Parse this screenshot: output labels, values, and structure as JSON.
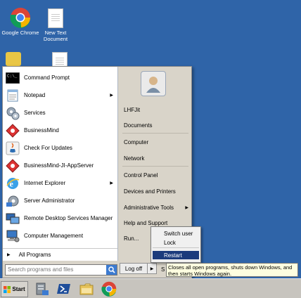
{
  "desktop": {
    "icons": [
      {
        "label": "Google Chrome",
        "icon": "chrome-icon"
      },
      {
        "label": "New Text\nDocument",
        "icon": "text-document-icon"
      }
    ]
  },
  "start_menu": {
    "programs": [
      {
        "label": "Command Prompt",
        "icon": "command-prompt-icon",
        "has_submenu": false
      },
      {
        "label": "Notepad",
        "icon": "notepad-icon",
        "has_submenu": true
      },
      {
        "label": "Services",
        "icon": "services-icon",
        "has_submenu": false
      },
      {
        "label": "BusinessMind",
        "icon": "businessmind-icon",
        "has_submenu": false
      },
      {
        "label": "Check For Updates",
        "icon": "java-icon",
        "has_submenu": false
      },
      {
        "label": "BusinessMind-JI-AppServer",
        "icon": "businessmind-appserver-icon",
        "has_submenu": false
      },
      {
        "label": "Internet Explorer",
        "icon": "internet-explorer-icon",
        "has_submenu": true
      },
      {
        "label": "Server Administrator",
        "icon": "server-admin-icon",
        "has_submenu": false
      },
      {
        "label": "Remote Desktop Services Manager",
        "icon": "remote-desktop-icon",
        "has_submenu": false
      },
      {
        "label": "Computer Management",
        "icon": "computer-management-icon",
        "has_submenu": false
      }
    ],
    "all_programs": "All Programs",
    "search_placeholder": "Search programs and files",
    "right": {
      "user": "LHFJit",
      "documents": "Documents",
      "computer": "Computer",
      "network": "Network",
      "control_panel": "Control Panel",
      "devices_printers": "Devices and Printers",
      "admin_tools": "Administrative Tools",
      "help_support": "Help and Support",
      "run": "Run..."
    },
    "log_off": "Log off",
    "shutdown_partial": "S"
  },
  "power_menu": {
    "switch_user": "Switch user",
    "lock": "Lock",
    "restart": "Restart"
  },
  "tooltip": "Closes all open programs, shuts down Windows, and then starts Windows again.",
  "taskbar": {
    "start_label": "Start",
    "pinned": [
      "server-manager-icon",
      "powershell-icon",
      "file-explorer-icon",
      "chrome-icon"
    ]
  },
  "colors": {
    "desktop": "#2f64a8",
    "highlight": "#1b3b7c",
    "tooltip_bg": "#fefee0"
  }
}
